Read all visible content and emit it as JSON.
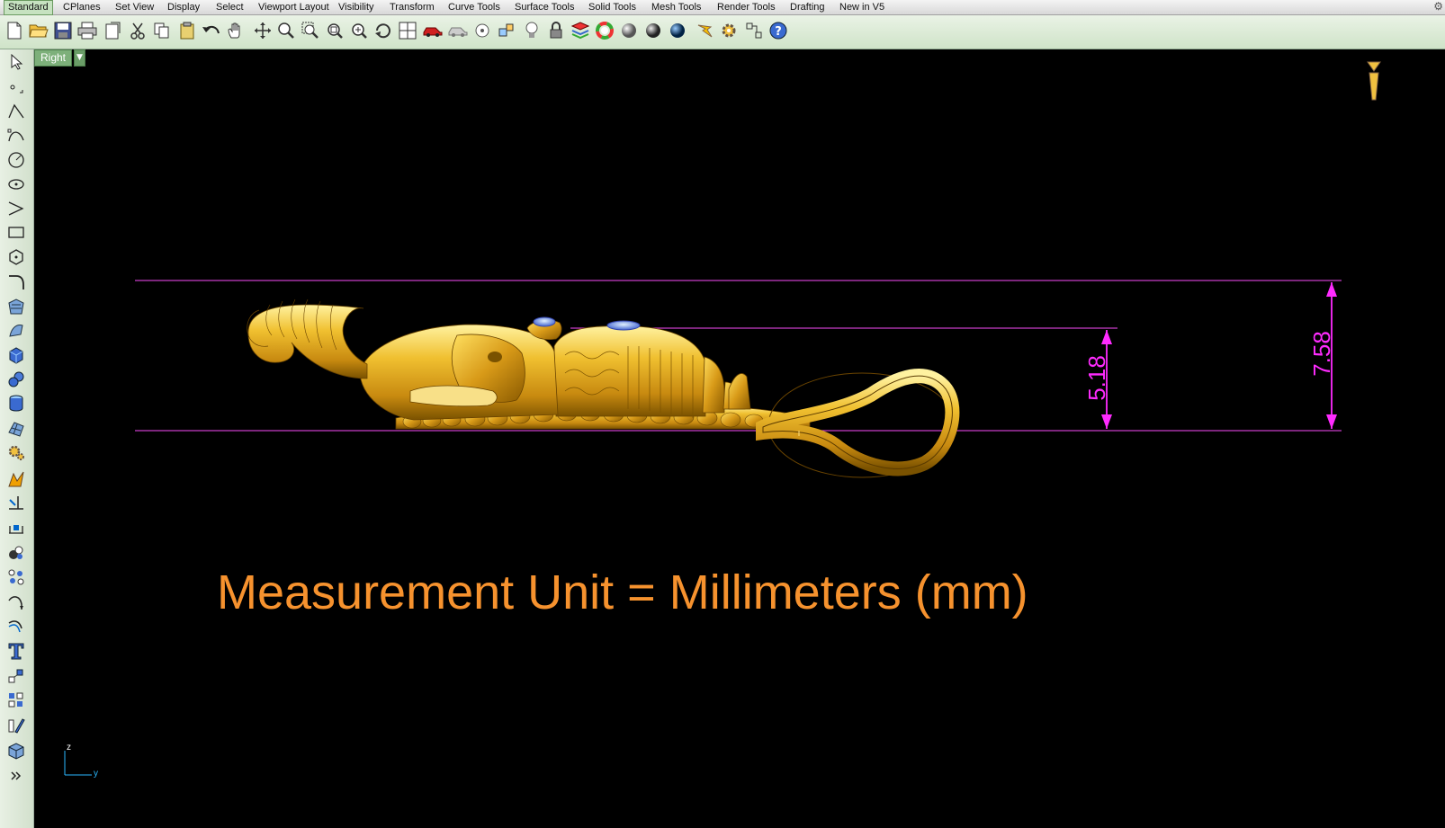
{
  "tabs": [
    {
      "label": "Standard",
      "active": true
    },
    {
      "label": "CPlanes"
    },
    {
      "label": "Set View"
    },
    {
      "label": "Display"
    },
    {
      "label": "Select"
    },
    {
      "label": "Viewport Layout"
    },
    {
      "label": "Visibility"
    },
    {
      "label": "Transform"
    },
    {
      "label": "Curve Tools"
    },
    {
      "label": "Surface Tools"
    },
    {
      "label": "Solid Tools"
    },
    {
      "label": "Mesh Tools"
    },
    {
      "label": "Render Tools"
    },
    {
      "label": "Drafting"
    },
    {
      "label": "New in V5"
    }
  ],
  "toolbar_icons": [
    "new-icon",
    "open-icon",
    "save-icon",
    "print-icon",
    "export-icon",
    "cut-icon",
    "copy-icon",
    "paste-icon",
    "undo-icon",
    "pan-hand-icon",
    "move-view-icon",
    "zoom-icon",
    "zoom-window-icon",
    "zoom-extents-icon",
    "zoom-selected-icon",
    "rotate-view-icon",
    "four-viewports-icon",
    "car-icon",
    "ghost-car-icon",
    "target-icon",
    "snap-icon",
    "lightbulb-icon",
    "lock-icon",
    "layer-icon",
    "color-wheel-icon",
    "sphere-shaded-icon",
    "sphere-render-icon",
    "sphere-blue-icon",
    "flash-icon",
    "gear-icon",
    "cplane-icon",
    "help-icon"
  ],
  "left_icons": [
    "select-arrow-icon",
    "point-icon",
    "polyline-icon",
    "curve-icon",
    "circle-icon",
    "ellipse-icon",
    "arc-icon",
    "rectangle-icon",
    "polygon-icon",
    "fillet-icon",
    "surface-icon",
    "sweep-icon",
    "box-icon",
    "spheres-icon",
    "cylinder-icon",
    "mesh-icon",
    "gear-solid-icon",
    "explode-icon",
    "trim-icon",
    "dimension-icon",
    "group-icon",
    "array-icon",
    "curve-edit-icon",
    "offset-icon",
    "text-icon",
    "transform-icon",
    "block-icon",
    "analyze-icon",
    "render-icon",
    "more-icon"
  ],
  "viewport": {
    "name": "Right",
    "caption": "Measurement Unit = Millimeters (mm)",
    "dims": {
      "small": "5.18",
      "large": "7.58"
    },
    "axis": {
      "z": "z",
      "y": "y"
    }
  },
  "colors": {
    "dimension": "#ff2bff",
    "caption": "#f6922e",
    "gold": "#e8b020"
  }
}
